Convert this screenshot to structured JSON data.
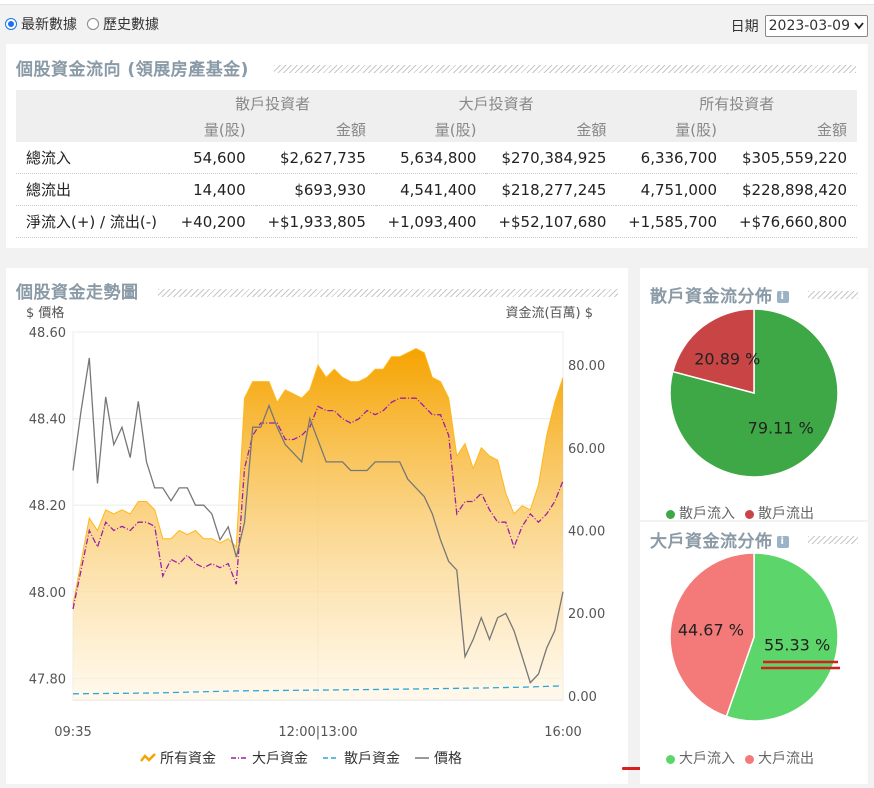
{
  "mode": {
    "latest_label": "最新數據",
    "history_label": "歷史數據"
  },
  "date": {
    "label": "日期",
    "value": "2023-03-09"
  },
  "flow_table": {
    "title": "個股資金流向 (領展房產基金)",
    "groups": [
      "散戶投資者",
      "大戶投資者",
      "所有投資者"
    ],
    "sub_headers": [
      "量(股)",
      "金額",
      "量(股)",
      "金額",
      "量(股)",
      "金額"
    ],
    "rows": [
      {
        "label": "總流入",
        "cells": [
          "54,600",
          "$2,627,735",
          "5,634,800",
          "$270,384,925",
          "6,336,700",
          "$305,559,220"
        ]
      },
      {
        "label": "總流出",
        "cells": [
          "14,400",
          "$693,930",
          "4,541,400",
          "$218,277,245",
          "4,751,000",
          "$228,898,420"
        ]
      },
      {
        "label": "淨流入(+) / 流出(-)",
        "cells": [
          "+40,200",
          "+$1,933,805",
          "+1,093,400",
          "+$52,107,680",
          "+1,585,700",
          "+$76,660,800"
        ]
      }
    ]
  },
  "trend": {
    "title": "個股資金走勢圖",
    "left_axis_label": "$ 價格",
    "right_axis_label": "資金流(百萬) $"
  },
  "colors": {
    "all_fund": "#f5a300",
    "big_fund": "#9b1fa8",
    "retail_fund": "#2aa6d8",
    "price": "#777777",
    "retail_in": "#3ea846",
    "retail_out": "#c94444",
    "big_in": "#5cd66a",
    "big_out": "#f47a7a"
  },
  "chart_data": [
    {
      "type": "line",
      "title": "個股資金走勢圖",
      "x_tick_labels": [
        "09:35",
        "12:00|13:00",
        "16:00"
      ],
      "y_left": {
        "label": "$ 價格",
        "ticks": [
          "48.60",
          "48.40",
          "48.20",
          "48.00",
          "47.80"
        ],
        "ylim": [
          47.75,
          48.6
        ]
      },
      "y_right": {
        "label": "資金流(百萬) $",
        "ticks": [
          "80.00",
          "60.00",
          "40.00",
          "20.00",
          "0.00"
        ],
        "ylim": [
          -1,
          88
        ]
      },
      "x_index_range": [
        0,
        60
      ],
      "grid": true,
      "legend_position": "bottom",
      "series": [
        {
          "name": "所有資金",
          "axis": "right",
          "style": "area",
          "points": [
            [
              0,
              22
            ],
            [
              2,
              43
            ],
            [
              3,
              40
            ],
            [
              4,
              45
            ],
            [
              5,
              44
            ],
            [
              6,
              45
            ],
            [
              7,
              44
            ],
            [
              8,
              47
            ],
            [
              9,
              47
            ],
            [
              10,
              45
            ],
            [
              11,
              38
            ],
            [
              12,
              38
            ],
            [
              13,
              40
            ],
            [
              14,
              39
            ],
            [
              15,
              40
            ],
            [
              16,
              38
            ],
            [
              17,
              38
            ],
            [
              18,
              37
            ],
            [
              19,
              38
            ],
            [
              20,
              36
            ],
            [
              21,
              72
            ],
            [
              22,
              76
            ],
            [
              23,
              76
            ],
            [
              24,
              76
            ],
            [
              25,
              71
            ],
            [
              26,
              74
            ],
            [
              27,
              73
            ],
            [
              28,
              72
            ],
            [
              29,
              74
            ],
            [
              30,
              80
            ],
            [
              31,
              77
            ],
            [
              32,
              79
            ],
            [
              33,
              77
            ],
            [
              34,
              76
            ],
            [
              35,
              76
            ],
            [
              36,
              77
            ],
            [
              37,
              79
            ],
            [
              38,
              79
            ],
            [
              39,
              82
            ],
            [
              40,
              82
            ],
            [
              41,
              83
            ],
            [
              42,
              84
            ],
            [
              43,
              83
            ],
            [
              44,
              77
            ],
            [
              45,
              76
            ],
            [
              46,
              72
            ],
            [
              47,
              58
            ],
            [
              48,
              61
            ],
            [
              49,
              55
            ],
            [
              50,
              60
            ],
            [
              51,
              58
            ],
            [
              52,
              57
            ],
            [
              53,
              49
            ],
            [
              54,
              44
            ],
            [
              55,
              46
            ],
            [
              56,
              45
            ],
            [
              57,
              51
            ],
            [
              58,
              63
            ],
            [
              59,
              71
            ],
            [
              60,
              77
            ]
          ]
        },
        {
          "name": "大戶資金",
          "axis": "right",
          "style": "dashdot",
          "points": [
            [
              0,
              21
            ],
            [
              2,
              40
            ],
            [
              3,
              36
            ],
            [
              4,
              42
            ],
            [
              5,
              40
            ],
            [
              6,
              41
            ],
            [
              7,
              40
            ],
            [
              8,
              42
            ],
            [
              9,
              42
            ],
            [
              10,
              41
            ],
            [
              11,
              29
            ],
            [
              12,
              33
            ],
            [
              13,
              32
            ],
            [
              14,
              34
            ],
            [
              15,
              32
            ],
            [
              16,
              31
            ],
            [
              17,
              32
            ],
            [
              18,
              31
            ],
            [
              19,
              32
            ],
            [
              20,
              27
            ],
            [
              21,
              55
            ],
            [
              22,
              63
            ],
            [
              23,
              66
            ],
            [
              24,
              66
            ],
            [
              25,
              66
            ],
            [
              26,
              62
            ],
            [
              27,
              62
            ],
            [
              28,
              63
            ],
            [
              29,
              65
            ],
            [
              30,
              70
            ],
            [
              31,
              69
            ],
            [
              32,
              69
            ],
            [
              33,
              67
            ],
            [
              34,
              66
            ],
            [
              35,
              67
            ],
            [
              36,
              69
            ],
            [
              37,
              68
            ],
            [
              38,
              69
            ],
            [
              39,
              71
            ],
            [
              40,
              72
            ],
            [
              41,
              72
            ],
            [
              42,
              72
            ],
            [
              43,
              70
            ],
            [
              44,
              68
            ],
            [
              45,
              68
            ],
            [
              46,
              63
            ],
            [
              47,
              44
            ],
            [
              48,
              47
            ],
            [
              49,
              47
            ],
            [
              50,
              49
            ],
            [
              51,
              45
            ],
            [
              52,
              42
            ],
            [
              53,
              42
            ],
            [
              54,
              36
            ],
            [
              55,
              41
            ],
            [
              56,
              44
            ],
            [
              57,
              42
            ],
            [
              58,
              44
            ],
            [
              59,
              47
            ],
            [
              60,
              52
            ]
          ]
        },
        {
          "name": "散戶資金",
          "axis": "right",
          "style": "dashed",
          "points": [
            [
              0,
              0.5
            ],
            [
              10,
              0.7
            ],
            [
              20,
              1.2
            ],
            [
              30,
              1.4
            ],
            [
              40,
              1.6
            ],
            [
              50,
              1.9
            ],
            [
              55,
              2.1
            ],
            [
              58,
              2.3
            ],
            [
              60,
              2.4
            ]
          ]
        },
        {
          "name": "價格",
          "axis": "left",
          "style": "solid",
          "points": [
            [
              0,
              48.28
            ],
            [
              1,
              48.42
            ],
            [
              2,
              48.54
            ],
            [
              3,
              48.25
            ],
            [
              4,
              48.45
            ],
            [
              5,
              48.34
            ],
            [
              6,
              48.38
            ],
            [
              7,
              48.31
            ],
            [
              8,
              48.44
            ],
            [
              9,
              48.3
            ],
            [
              10,
              48.24
            ],
            [
              11,
              48.24
            ],
            [
              12,
              48.21
            ],
            [
              13,
              48.24
            ],
            [
              14,
              48.24
            ],
            [
              15,
              48.2
            ],
            [
              16,
              48.2
            ],
            [
              17,
              48.18
            ],
            [
              18,
              48.12
            ],
            [
              19,
              48.15
            ],
            [
              20,
              48.08
            ],
            [
              21,
              48.16
            ],
            [
              22,
              48.38
            ],
            [
              23,
              48.38
            ],
            [
              24,
              48.43
            ],
            [
              25,
              48.38
            ],
            [
              26,
              48.34
            ],
            [
              27,
              48.32
            ],
            [
              28,
              48.3
            ],
            [
              29,
              48.4
            ],
            [
              30,
              48.35
            ],
            [
              31,
              48.3
            ],
            [
              32,
              48.3
            ],
            [
              33,
              48.3
            ],
            [
              34,
              48.28
            ],
            [
              35,
              48.28
            ],
            [
              36,
              48.28
            ],
            [
              37,
              48.3
            ],
            [
              38,
              48.3
            ],
            [
              39,
              48.3
            ],
            [
              40,
              48.3
            ],
            [
              41,
              48.26
            ],
            [
              42,
              48.24
            ],
            [
              43,
              48.22
            ],
            [
              44,
              48.18
            ],
            [
              45,
              48.12
            ],
            [
              46,
              48.07
            ],
            [
              47,
              48.05
            ],
            [
              48,
              47.85
            ],
            [
              49,
              47.89
            ],
            [
              50,
              47.94
            ],
            [
              51,
              47.89
            ],
            [
              52,
              47.94
            ],
            [
              53,
              47.95
            ],
            [
              54,
              47.91
            ],
            [
              55,
              47.85
            ],
            [
              56,
              47.79
            ],
            [
              57,
              47.81
            ],
            [
              58,
              47.87
            ],
            [
              59,
              47.91
            ],
            [
              60,
              48.0
            ]
          ]
        }
      ]
    },
    {
      "type": "pie",
      "title": "散戶資金流分佈",
      "labels": [
        "散戶流入",
        "散戶流出"
      ],
      "values": [
        79.11,
        20.89
      ],
      "value_labels": [
        "79.11 %",
        "20.89 %"
      ],
      "legend_position": "bottom"
    },
    {
      "type": "pie",
      "title": "大戶資金流分佈",
      "labels": [
        "大戶流入",
        "大戶流出"
      ],
      "values": [
        55.33,
        44.67
      ],
      "value_labels": [
        "55.33 %",
        "44.67 %"
      ],
      "legend_position": "bottom"
    }
  ],
  "icons": {
    "info": "i",
    "dropdown": "chevron-down-icon"
  }
}
